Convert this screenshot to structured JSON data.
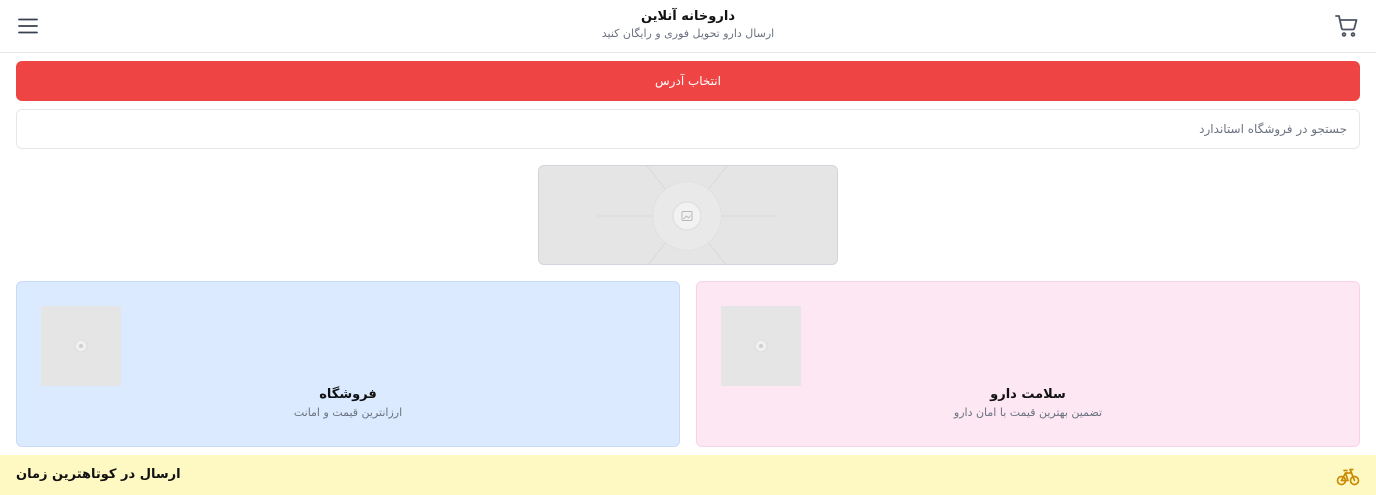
{
  "header": {
    "title": "داروخانه آنلاین",
    "subtitle": "ارسال دارو تحویل فوری و رایگان کنید",
    "cart_icon": "cart-icon",
    "menu_icon": "hamburger-menu-icon"
  },
  "address_button": {
    "label": "انتخاب آدرس",
    "color": "#ef4444"
  },
  "search": {
    "placeholder": "جستجو در فروشگاه استاندارد",
    "value": ""
  },
  "banner": {
    "icon": "image-placeholder-icon"
  },
  "categories": [
    {
      "title": "سلامت دارو",
      "subtitle": "تضمین بهترین قیمت با امان دارو",
      "color": "#fce7f3",
      "icon": "image-placeholder-icon"
    },
    {
      "title": "فروشگاه",
      "subtitle": "ارزانترین قیمت و امانت",
      "color": "#dbeafe",
      "icon": "image-placeholder-icon"
    }
  ],
  "delivery": {
    "text": "ارسال در کوتاهترین زمان",
    "icon": "bicycle-icon",
    "icon_color": "#ca8a04",
    "bar_color": "#fef9c3"
  }
}
